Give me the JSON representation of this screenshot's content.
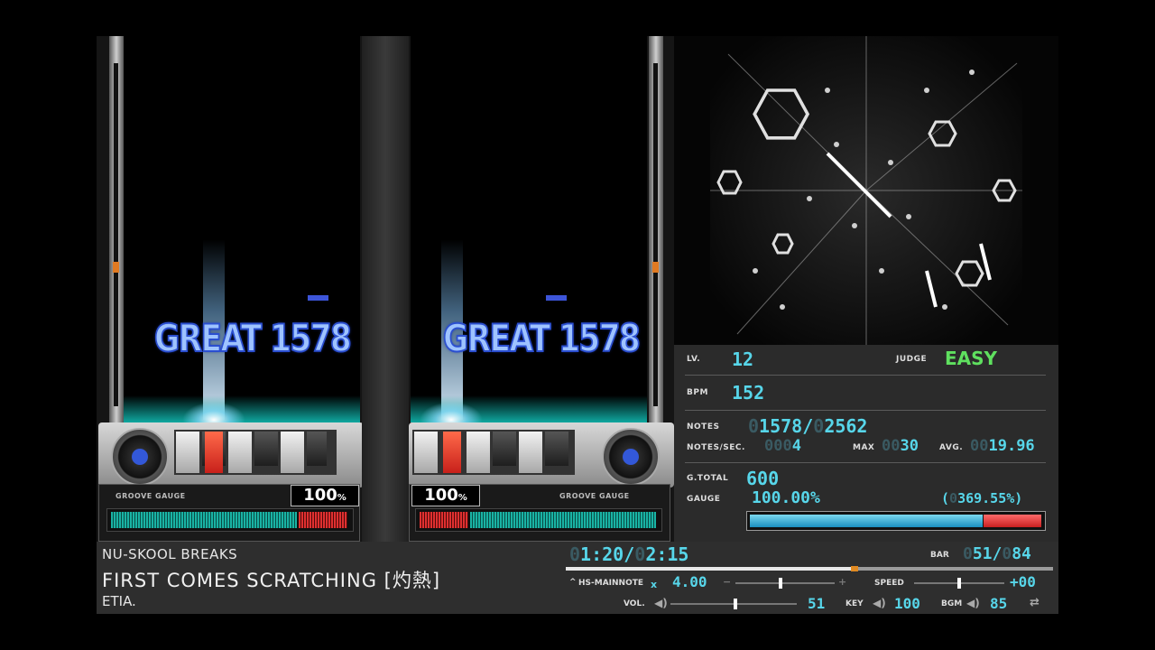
{
  "play": {
    "judge_text": "GREAT",
    "combo": "1578",
    "gauge_label": "GROOVE GAUGE",
    "gauge_percent": "100",
    "gauge_percent_unit": "%",
    "gauge_fill_fraction": 1.0
  },
  "info": {
    "level_label": "LV.",
    "level": "12",
    "judge_label": "JUDGE",
    "judge": "EASY",
    "bpm_label": "BPM",
    "bpm": "152",
    "notes_label": "NOTES",
    "notes_current_pad": "0",
    "notes_current": "1578",
    "notes_separator": "/",
    "notes_total_pad": "0",
    "notes_total": "2562",
    "nps_label": "NOTES/SEC.",
    "nps_pad": "000",
    "nps": "4",
    "max_label": "MAX",
    "max_pad": "00",
    "max": "30",
    "avg_label": "AVG.",
    "avg_pad": "00",
    "avg": "19.96",
    "gtotal_label": "G.TOTAL",
    "gtotal": "600",
    "gauge_label": "GAUGE",
    "gauge": "100.00%",
    "gauge_extra_open": "(",
    "gauge_extra_pad": "0",
    "gauge_extra": "369.55%)",
    "gauge_bar_fraction": 1.0
  },
  "song": {
    "genre": "NU-SKOOL BREAKS",
    "title": "FIRST COMES SCRATCHING [灼熱]",
    "artist": "ETIA."
  },
  "status": {
    "time_pad": "0",
    "time_elapsed": "1:20",
    "time_sep": "/",
    "time_total_pad": "0",
    "time_total": "2:15",
    "progress_fraction": 0.59,
    "bar_label": "BAR",
    "bar_pad": "0",
    "bar_current": "51",
    "bar_sep": "/",
    "bar_total_pad": "0",
    "bar_total": "84",
    "hs_label": "HS-MAINNOTE",
    "hs_x": "x",
    "hs_value": "4.00",
    "hs_minus": "−",
    "hs_plus": "+",
    "speed_label": "SPEED",
    "speed_value": "+00",
    "vol_label": "VOL.",
    "vol_value": "51",
    "key_label": "KEY",
    "key_value": "100",
    "bgm_label": "BGM",
    "bgm_value": "85"
  },
  "colors": {
    "accent_cyan": "#57d6ea",
    "judge_easy": "#5fe05f",
    "gauge_teal": "#19b3a4",
    "gauge_red": "#e03030",
    "note_blue": "#3d55d9",
    "judge_line_red": "#d62b2b"
  }
}
